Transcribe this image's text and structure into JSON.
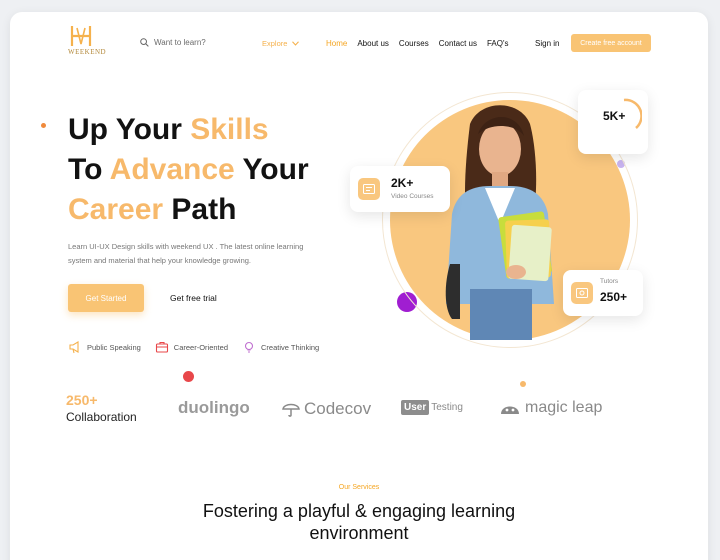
{
  "brand": {
    "name": "WEEKEND"
  },
  "header": {
    "search_placeholder": "Want to learn?",
    "explore_label": "Explore",
    "nav": [
      "Home",
      "About us",
      "Courses",
      "Contact us",
      "FAQ's"
    ],
    "signin_label": "Sign in",
    "cta_label": "Create free account"
  },
  "hero": {
    "title_line1_a": "Up Your ",
    "title_line1_b": "Skills",
    "title_line2_a": "To ",
    "title_line2_b": "Advance",
    "title_line2_c": " Your",
    "title_line3_a": "Career",
    "title_line3_b": " Path",
    "subtitle": "Learn UI-UX Design skills with weekend UX . The latest online learning system and material that help your knowledge growing.",
    "primary_button": "Get Started",
    "secondary_button": "Get free trial",
    "features": [
      {
        "label": "Public Speaking",
        "icon": "megaphone-icon"
      },
      {
        "label": "Career-Oriented",
        "icon": "briefcase-icon"
      },
      {
        "label": "Creative Thinking",
        "icon": "lightbulb-icon"
      }
    ]
  },
  "stats": {
    "learners_value": "5K+",
    "courses_value": "2K+",
    "courses_label": "Video Courses",
    "tutors_label": "Tutors",
    "tutors_value": "250+"
  },
  "collaboration": {
    "value": "250+",
    "label": "Collaboration",
    "brands": [
      "duolingo",
      "Codecov",
      "User",
      "Testing",
      "magic leap"
    ]
  },
  "services": {
    "label": "Our Services",
    "title_line1": "Fostering a playful & engaging learning",
    "title_line2": "environment"
  },
  "colors": {
    "accent": "#f7b96b",
    "accent_strong": "#f5a623",
    "purple_dot": "#a01ed1",
    "red_dot": "#e8474a"
  }
}
